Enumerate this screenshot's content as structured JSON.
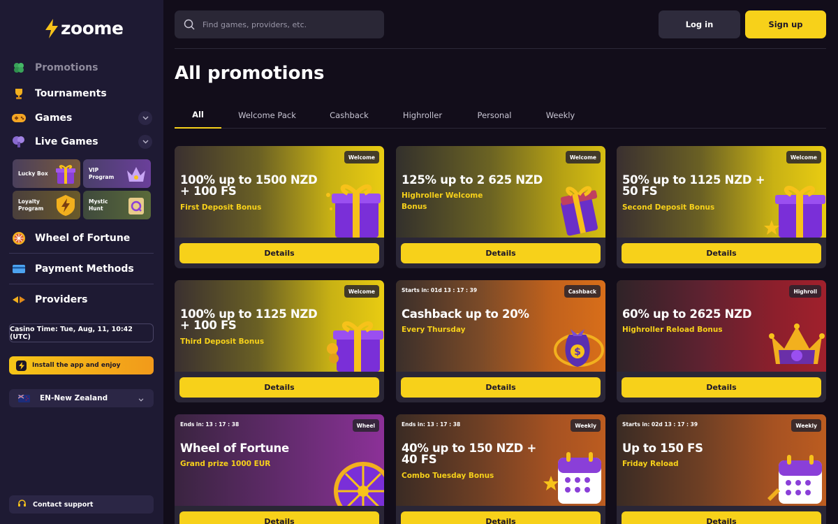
{
  "brand": {
    "name": "zoome"
  },
  "sidebar": {
    "nav": [
      {
        "label": "Promotions",
        "icon": "clover-icon"
      },
      {
        "label": "Tournaments",
        "icon": "trophy-icon"
      },
      {
        "label": "Games",
        "icon": "gamepad-icon"
      },
      {
        "label": "Live Games",
        "icon": "cards-icon"
      }
    ],
    "tiles": [
      {
        "label": "Lucky Box",
        "icon": "gift-box-icon"
      },
      {
        "label": "VIP Program",
        "icon": "crown-icon"
      },
      {
        "label": "Loyalty Program",
        "icon": "bolt-shield-icon"
      },
      {
        "label": "Mystic Hunt",
        "icon": "scroll-icon"
      }
    ],
    "nav2": [
      {
        "label": "Wheel of Fortune",
        "icon": "wheel-icon"
      },
      {
        "label": "Payment Methods",
        "icon": "card-icon"
      },
      {
        "label": "Providers",
        "icon": "providers-icon"
      }
    ],
    "casino_time": "Casino Time: Tue, Aug, 11, 10:42 (UTC)",
    "install_label": "Install the app and enjoy",
    "language": "EN-New Zealand",
    "support_label": "Contact support"
  },
  "header": {
    "search_placeholder": "Find games, providers, etc.",
    "login_label": "Log in",
    "signup_label": "Sign up"
  },
  "page": {
    "title": "All promotions",
    "tabs": [
      "All",
      "Welcome Pack",
      "Cashback",
      "Highroller",
      "Personal",
      "Weekly"
    ],
    "active_tab": "All"
  },
  "promotions": [
    {
      "tag": "Welcome",
      "timer": "",
      "title": "100% up to 1500 NZD + 100 FS",
      "subtitle": "First Deposit Bonus",
      "button": "Details"
    },
    {
      "tag": "Welcome",
      "timer": "",
      "title": "125% up to 2 625 NZD",
      "subtitle": "Highroller Welcome Bonus",
      "button": "Details"
    },
    {
      "tag": "Welcome",
      "timer": "",
      "title": "50% up to 1125 NZD + 50 FS",
      "subtitle": "Second Deposit Bonus",
      "button": "Details"
    },
    {
      "tag": "Welcome",
      "timer": "",
      "title": "100% up to 1125 NZD + 100 FS",
      "subtitle": "Third Deposit Bonus",
      "button": "Details"
    },
    {
      "tag": "Cashback",
      "timer": "Starts in: 01d 13 : 17 : 39",
      "title": "Cashback up to 20%",
      "subtitle": "Every Thursday",
      "button": "Details"
    },
    {
      "tag": "Highroll",
      "timer": "",
      "title": "60% up to 2625 NZD",
      "subtitle": "Highroller Reload Bonus",
      "button": "Details"
    },
    {
      "tag": "Wheel",
      "timer": "Ends in: 13 : 17 : 38",
      "title": "Wheel of Fortune",
      "subtitle": "Grand prize 1000 EUR",
      "button": "Details"
    },
    {
      "tag": "Weekly",
      "timer": "Ends in: 13 : 17 : 38",
      "title": "40% up to 150 NZD + 40 FS",
      "subtitle": "Combo Tuesday Bonus",
      "button": "Details"
    },
    {
      "tag": "Weekly",
      "timer": "Starts in: 02d 13 : 17 : 39",
      "title": "Up to 150 FS",
      "subtitle": "Friday Reload",
      "button": "Details"
    }
  ],
  "colors": {
    "accent": "#f7d11a",
    "sidebar": "#1e1a33",
    "background": "#120d1a"
  }
}
